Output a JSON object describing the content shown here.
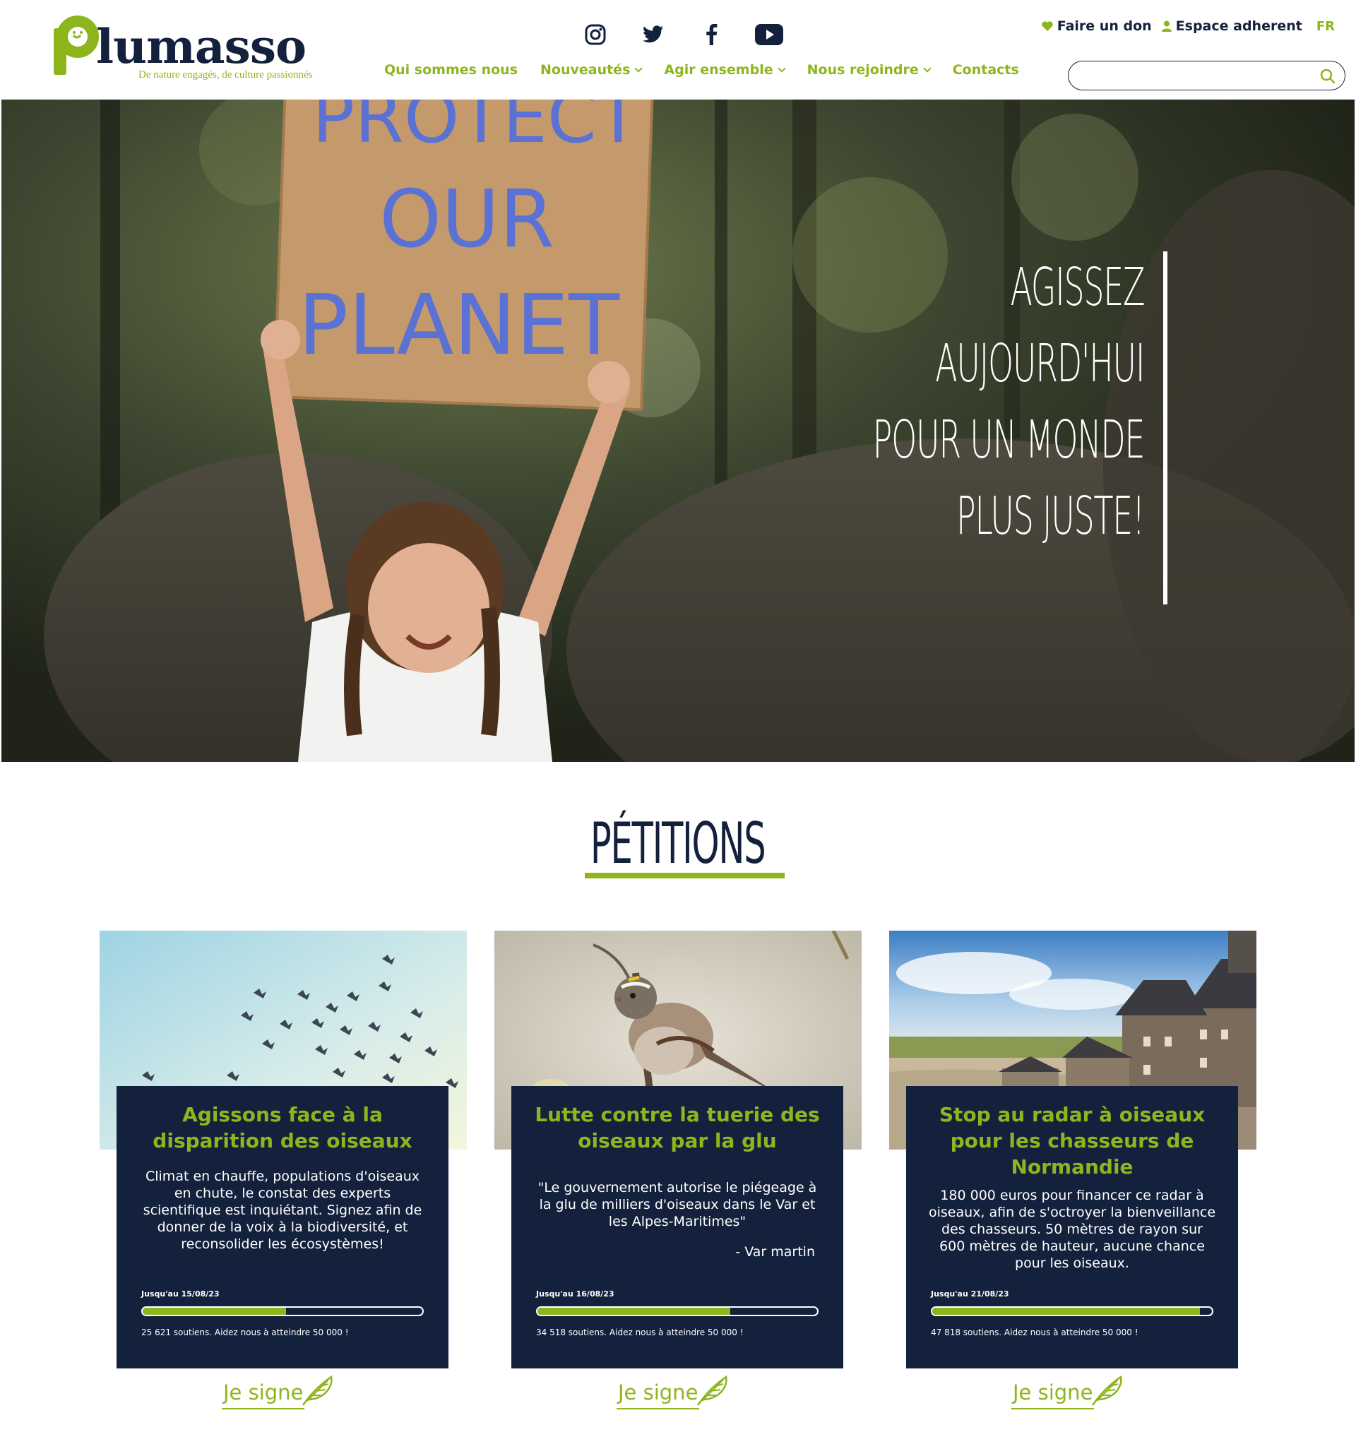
{
  "brand": {
    "name": "lumasso",
    "tagline": "De nature engagés, de culture passionnés",
    "accent": "#8db51c",
    "navy": "#14213d"
  },
  "social": [
    {
      "icon": "instagram-icon"
    },
    {
      "icon": "twitter-icon"
    },
    {
      "icon": "facebook-icon"
    },
    {
      "icon": "youtube-icon"
    }
  ],
  "toplinks": {
    "donate": "Faire un don",
    "member": "Espace adherent",
    "lang": "FR"
  },
  "search": {
    "placeholder": "",
    "value": ""
  },
  "nav": [
    {
      "label": "Qui sommes nous",
      "dropdown": false
    },
    {
      "label": "Nouveautés",
      "dropdown": true
    },
    {
      "label": "Agir ensemble",
      "dropdown": true
    },
    {
      "label": "Nous rejoindre",
      "dropdown": true
    },
    {
      "label": "Contacts",
      "dropdown": false
    }
  ],
  "hero": {
    "sign_text": [
      "PROTECT",
      "OUR",
      "PLANET"
    ],
    "lines": [
      "AGISSEZ",
      "AUJOURD'HUI",
      "POUR UN MONDE",
      "PLUS JUSTE!"
    ]
  },
  "petitions": {
    "title": "PÉTITIONS",
    "sign_label": "Je signe",
    "cards": [
      {
        "title": "Agissons face à la disparition des oiseaux",
        "description": "Climat en chauffe, populations d'oiseaux en chute, le constat des experts scientifique est inquiétant. Signez afin de donner de la voix à la biodiversité, et reconsolider les écosystèmes!",
        "attribution": "",
        "deadline": "Jusqu'au 15/08/23",
        "progress": 0.51242,
        "supporters": "25 621 soutiens. Aidez nous à atteindre 50 000 !",
        "image": "birds-flock-sky"
      },
      {
        "title": "Lutte contre la tuerie des oiseaux par la glu",
        "description": "\"Le gouvernement autorise le piégeage à la glu de milliers d'oiseaux dans le Var et les Alpes-Maritimes\"",
        "attribution": "- Var martin",
        "deadline": "Jusqu'au 16/08/23",
        "progress": 0.69036,
        "supporters": "34 518 soutiens. Aidez nous à atteindre 50 000 !",
        "image": "sparrow-on-branch"
      },
      {
        "title": "Stop au radar à oiseaux pour les chasseurs de Normandie",
        "description": "180 000 euros pour financer ce radar à oiseaux, afin de s'octroyer la bienveillance des chasseurs. 50 mètres de rayon sur 600 mètres de hauteur, aucune chance pour les oiseaux.",
        "attribution": "",
        "deadline": "Jusqu'au 21/08/23",
        "progress": 0.95636,
        "supporters": "47 818 soutiens. Aidez nous à atteindre 50 000 !",
        "image": "mont-saint-michel"
      }
    ]
  }
}
